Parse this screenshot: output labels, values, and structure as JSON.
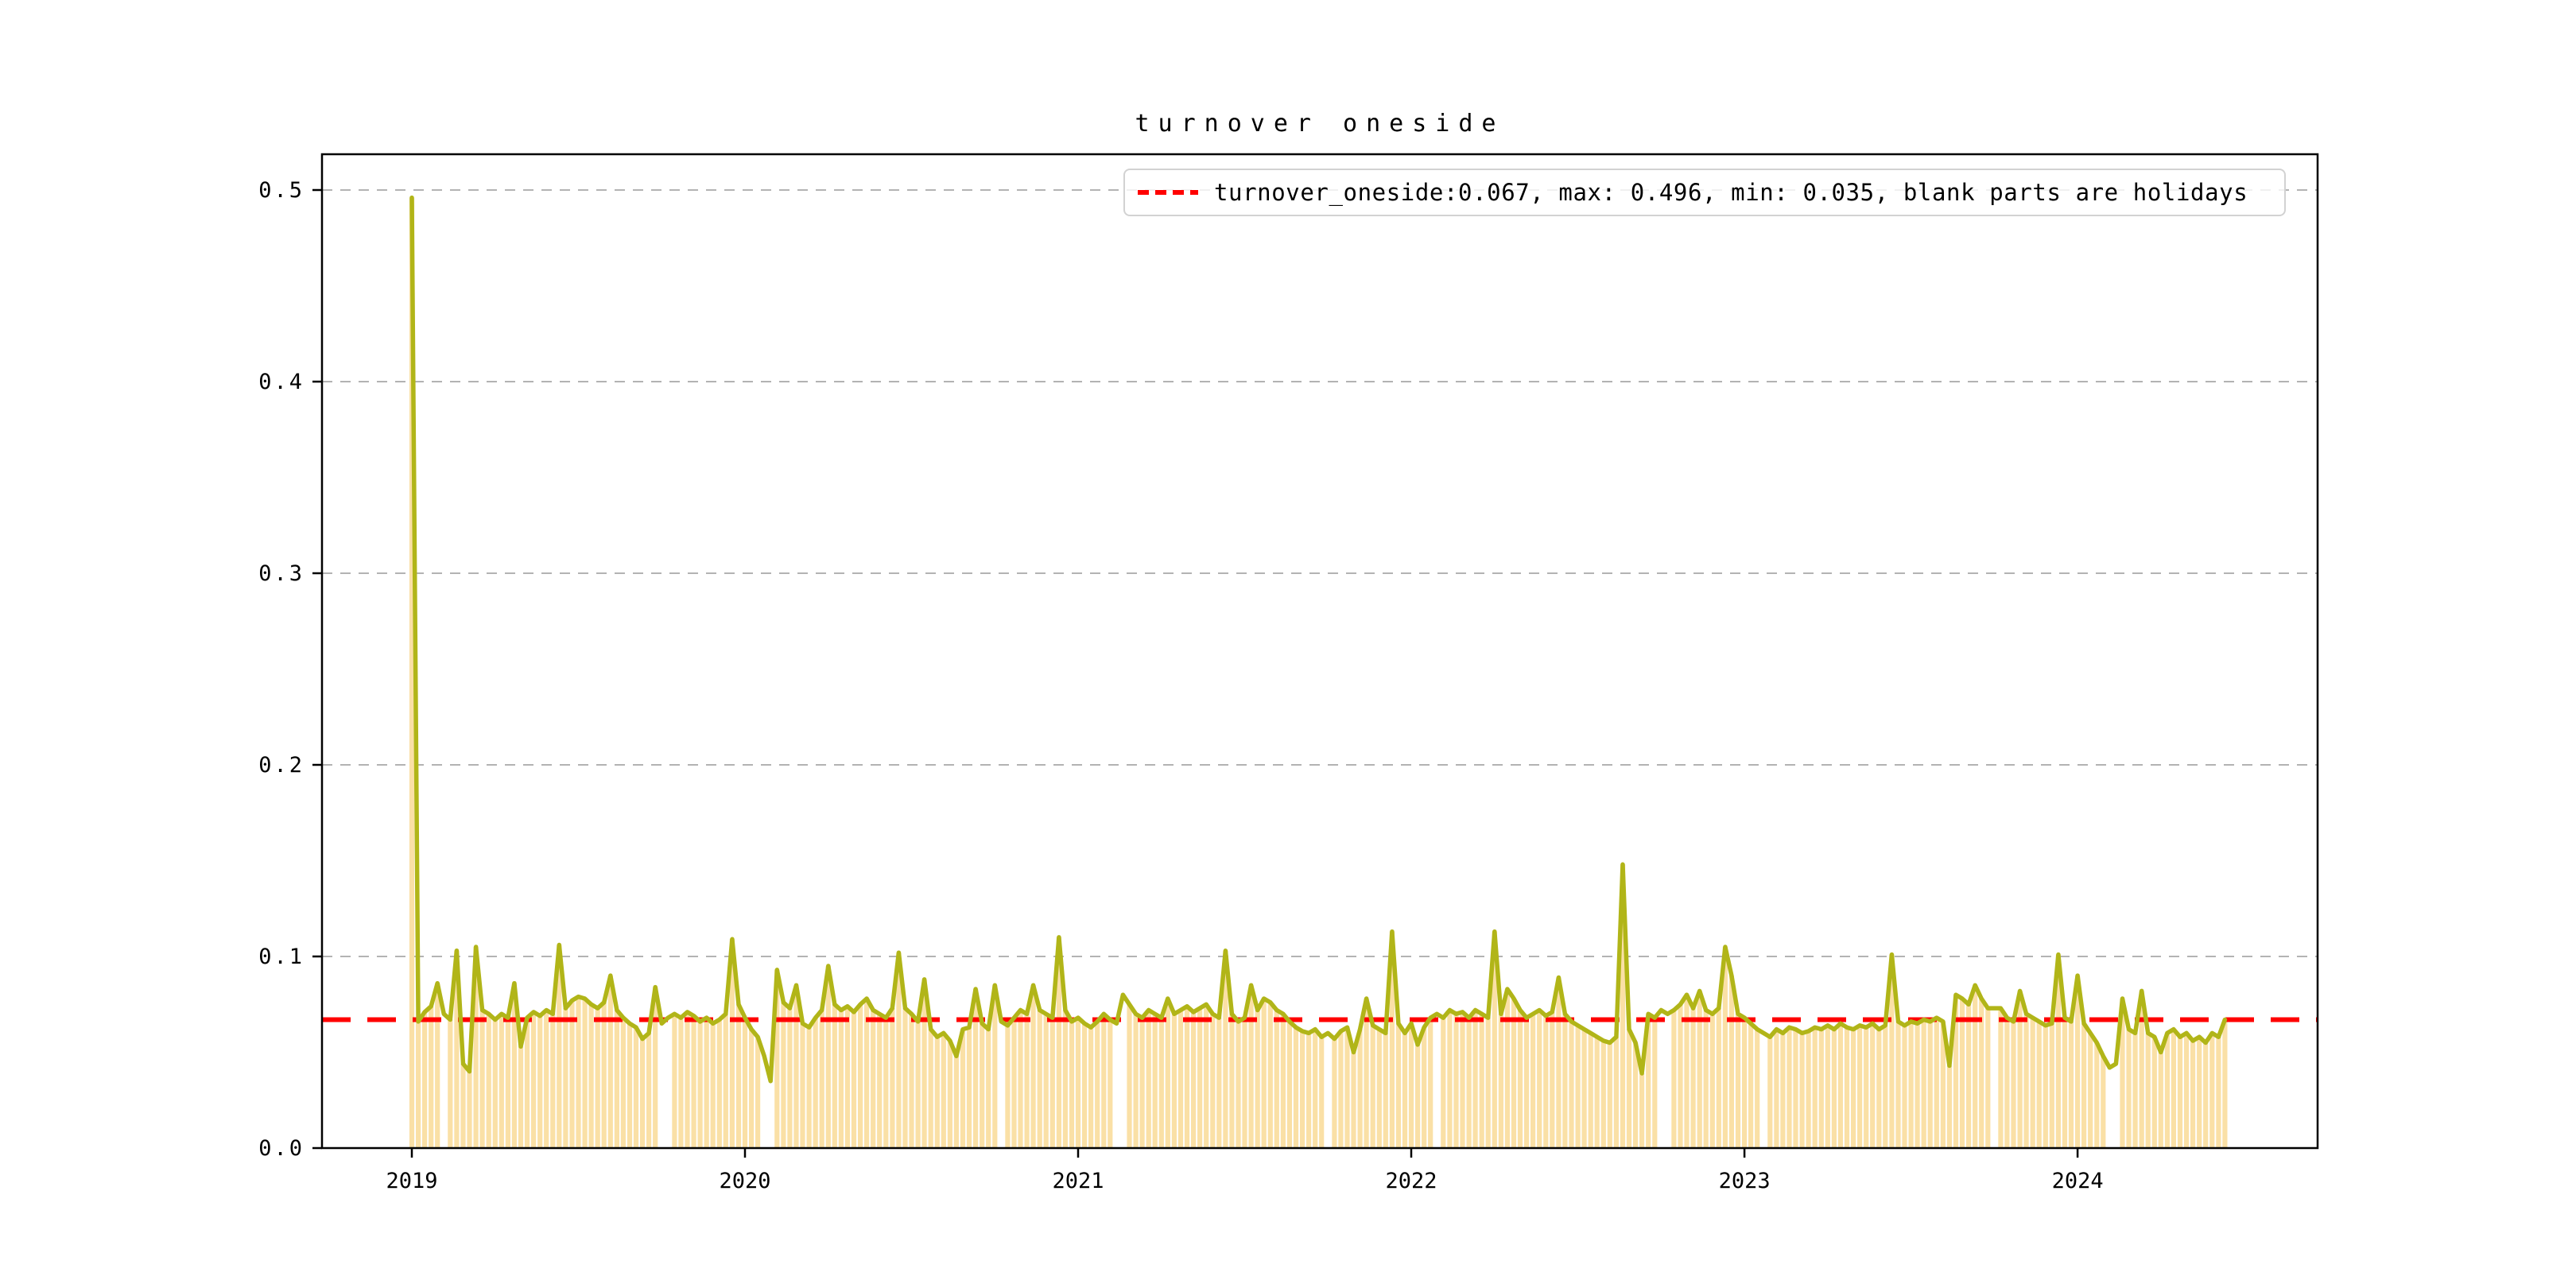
{
  "colors": {
    "background": "#ffffff",
    "line": "#b1b518",
    "bars": "#fae0a6",
    "mean_line": "#ff0000",
    "grid": "#b3b3b3",
    "axis": "#000000",
    "legend_border": "#d2d2d2"
  },
  "chart_data": {
    "type": "line",
    "title": "turnover oneside",
    "legend": {
      "label": "turnover_oneside:0.067, max: 0.496, min: 0.035, blank parts are holidays",
      "position": "upper right",
      "sample_style": "red-dashed-line"
    },
    "stats": {
      "current": 0.067,
      "max": 0.496,
      "min": 0.035
    },
    "mean_line_value": 0.067,
    "ylim": [
      0.0,
      0.518
    ],
    "y_ticks": [
      0.0,
      0.1,
      0.2,
      0.3,
      0.4,
      0.5
    ],
    "y_tick_labels": [
      "0.0",
      "0.1",
      "0.2",
      "0.3",
      "0.4",
      "0.5"
    ],
    "x_tick_labels": [
      "2019",
      "2020",
      "2021",
      "2022",
      "2023",
      "2024"
    ],
    "grid": "dashed-horizontal",
    "frequency": "weekly",
    "weeks_per_year": 52,
    "note": "orange bars rise from 0 to each weekly value; blank bar gaps are holiday weeks",
    "values": [
      0.496,
      0.066,
      0.071,
      0.074,
      0.086,
      0.07,
      0.067,
      0.103,
      0.044,
      0.04,
      0.105,
      0.072,
      0.07,
      0.067,
      0.07,
      0.068,
      0.086,
      0.053,
      0.068,
      0.071,
      0.069,
      0.072,
      0.07,
      0.106,
      0.073,
      0.077,
      0.079,
      0.078,
      0.075,
      0.073,
      0.076,
      0.09,
      0.072,
      0.068,
      0.065,
      0.063,
      0.057,
      0.06,
      0.084,
      0.065,
      0.068,
      0.07,
      0.068,
      0.071,
      0.069,
      0.066,
      0.068,
      0.065,
      0.067,
      0.07,
      0.109,
      0.075,
      0.068,
      0.062,
      0.058,
      0.048,
      0.035,
      0.093,
      0.076,
      0.073,
      0.085,
      0.065,
      0.063,
      0.068,
      0.072,
      0.095,
      0.075,
      0.072,
      0.074,
      0.071,
      0.075,
      0.078,
      0.072,
      0.07,
      0.068,
      0.073,
      0.102,
      0.073,
      0.07,
      0.066,
      0.088,
      0.062,
      0.058,
      0.06,
      0.056,
      0.048,
      0.062,
      0.063,
      0.083,
      0.065,
      0.062,
      0.085,
      0.066,
      0.064,
      0.068,
      0.072,
      0.07,
      0.085,
      0.072,
      0.07,
      0.068,
      0.11,
      0.072,
      0.066,
      0.068,
      0.065,
      0.063,
      0.066,
      0.07,
      0.067,
      0.065,
      0.08,
      0.075,
      0.07,
      0.068,
      0.072,
      0.07,
      0.068,
      0.078,
      0.07,
      0.072,
      0.074,
      0.071,
      0.073,
      0.075,
      0.07,
      0.068,
      0.103,
      0.07,
      0.066,
      0.068,
      0.085,
      0.072,
      0.078,
      0.076,
      0.072,
      0.07,
      0.066,
      0.063,
      0.061,
      0.06,
      0.062,
      0.058,
      0.06,
      0.057,
      0.061,
      0.063,
      0.05,
      0.062,
      0.078,
      0.064,
      0.062,
      0.06,
      0.113,
      0.065,
      0.06,
      0.065,
      0.054,
      0.063,
      0.068,
      0.07,
      0.068,
      0.072,
      0.07,
      0.071,
      0.068,
      0.072,
      0.07,
      0.068,
      0.113,
      0.07,
      0.083,
      0.078,
      0.072,
      0.068,
      0.07,
      0.072,
      0.069,
      0.071,
      0.089,
      0.07,
      0.066,
      0.064,
      0.062,
      0.06,
      0.058,
      0.056,
      0.055,
      0.058,
      0.148,
      0.062,
      0.055,
      0.039,
      0.07,
      0.068,
      0.072,
      0.07,
      0.072,
      0.075,
      0.08,
      0.073,
      0.082,
      0.072,
      0.07,
      0.073,
      0.105,
      0.09,
      0.07,
      0.068,
      0.065,
      0.062,
      0.06,
      0.058,
      0.062,
      0.06,
      0.063,
      0.062,
      0.06,
      0.061,
      0.063,
      0.062,
      0.064,
      0.062,
      0.065,
      0.063,
      0.062,
      0.064,
      0.063,
      0.065,
      0.062,
      0.064,
      0.101,
      0.066,
      0.064,
      0.066,
      0.065,
      0.067,
      0.066,
      0.068,
      0.066,
      0.043,
      0.08,
      0.078,
      0.075,
      0.085,
      0.078,
      0.073,
      0.073,
      0.073,
      0.068,
      0.066,
      0.082,
      0.07,
      0.068,
      0.066,
      0.064,
      0.065,
      0.101,
      0.068,
      0.066,
      0.09,
      0.065,
      0.06,
      0.055,
      0.048,
      0.042,
      0.044,
      0.078,
      0.062,
      0.06,
      0.082,
      0.06,
      0.058,
      0.05,
      0.06,
      0.062,
      0.058,
      0.06,
      0.056,
      0.058,
      0.055,
      0.06,
      0.058,
      0.067
    ],
    "holiday_no_bar_weeks": [
      5,
      39,
      40,
      55,
      56,
      92,
      110,
      111,
      143,
      160,
      195,
      196,
      211,
      247,
      265,
      266
    ]
  }
}
